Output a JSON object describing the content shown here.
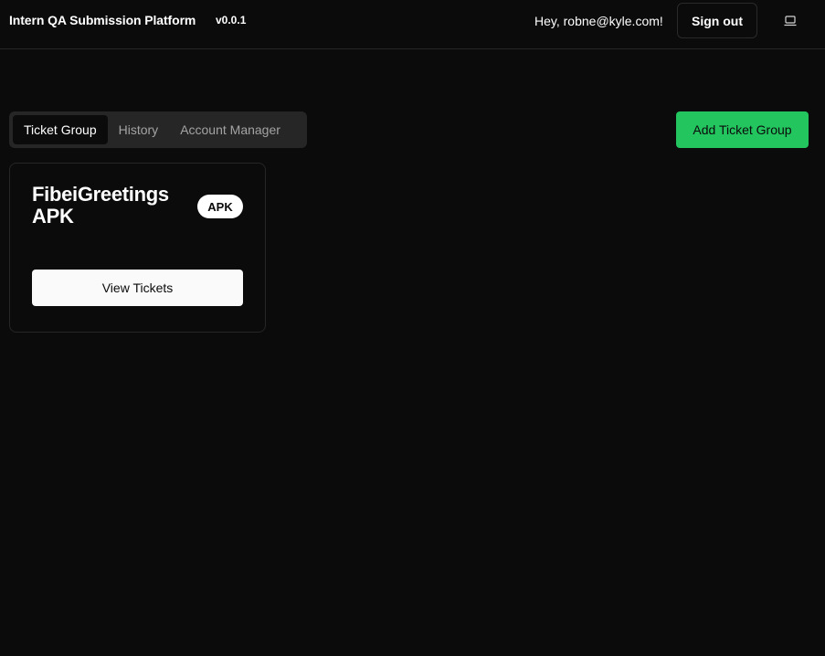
{
  "header": {
    "app_title": "Intern QA Submission Platform",
    "version": "v0.0.1",
    "greeting": "Hey, robne@kyle.com!",
    "signout_label": "Sign out",
    "theme_icon": "laptop-icon"
  },
  "tabs": [
    {
      "label": "Ticket Group",
      "active": true
    },
    {
      "label": "History",
      "active": false
    },
    {
      "label": "Account Manager",
      "active": false
    }
  ],
  "actions": {
    "add_ticket_group_label": "Add Ticket Group"
  },
  "ticket_groups": [
    {
      "name": "FibeiGreetings APK",
      "badge": "APK",
      "button_label": "View Tickets"
    }
  ],
  "colors": {
    "background": "#0b0b0b",
    "accent_green": "#22c55e",
    "border": "#262626",
    "tab_bg": "#262626"
  }
}
